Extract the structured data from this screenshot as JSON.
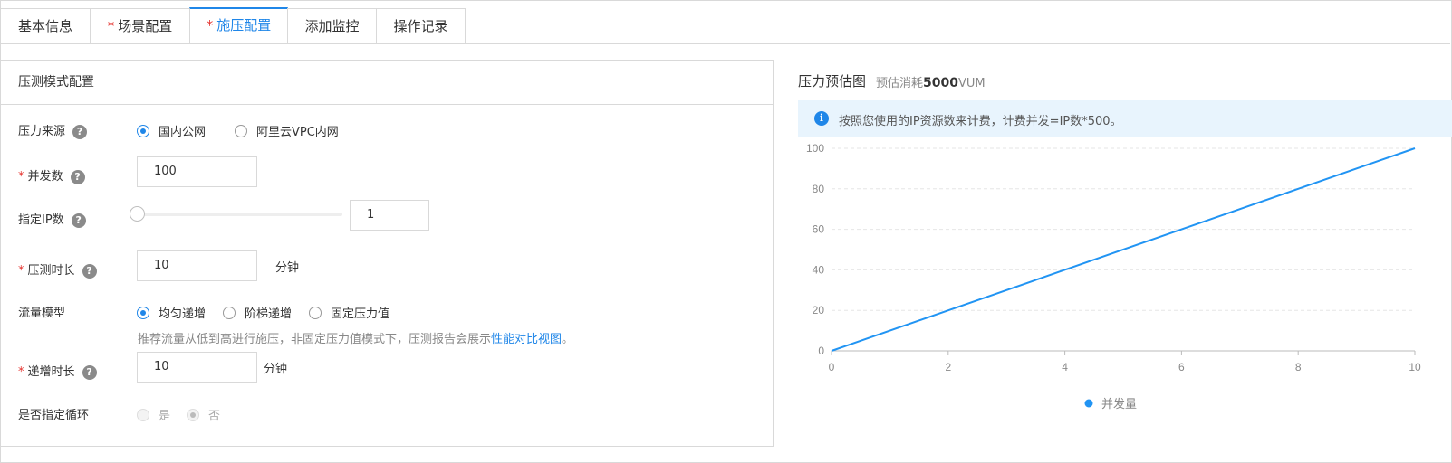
{
  "tabs": [
    {
      "label": "基本信息",
      "required": false,
      "active": false
    },
    {
      "label": "场景配置",
      "required": true,
      "active": false
    },
    {
      "label": "施压配置",
      "required": true,
      "active": true
    },
    {
      "label": "添加监控",
      "required": false,
      "active": false
    },
    {
      "label": "操作记录",
      "required": false,
      "active": false
    }
  ],
  "panel": {
    "title": "压测模式配置",
    "pressure_source": {
      "label": "压力来源",
      "options": [
        "国内公网",
        "阿里云VPC内网"
      ],
      "selected": "国内公网"
    },
    "concurrency": {
      "label": "并发数",
      "value": "100"
    },
    "ip_count": {
      "label": "指定IP数",
      "value": "1",
      "slider_fraction": 0
    },
    "duration": {
      "label": "压测时长",
      "value": "10",
      "unit": "分钟"
    },
    "traffic_model": {
      "label": "流量模型",
      "options": [
        "均匀递增",
        "阶梯递增",
        "固定压力值"
      ],
      "selected": "均匀递增"
    },
    "hint": {
      "text": "推荐流量从低到高进行施压，非固定压力值模式下，压测报告会展示",
      "link": "性能对比视图",
      "suffix": "。"
    },
    "ramp_duration": {
      "label": "递增时长",
      "value": "10",
      "unit": "分钟"
    },
    "loop": {
      "label": "是否指定循环",
      "options": [
        "是",
        "否"
      ],
      "selected": "否",
      "disabled": true
    },
    "help_glyph": "?"
  },
  "chart_panel": {
    "title": "压力预估图",
    "cost_prefix": "预估消耗",
    "cost_value": "5000",
    "cost_unit": "VUM",
    "info_glyph": "i",
    "notice": "按照您使用的IP资源数来计费，计费并发=IP数*500。"
  },
  "colors": {
    "accent": "#1f86e8",
    "required": "#e5332f",
    "line": "#2194f3"
  },
  "chart_data": {
    "type": "line",
    "x": [
      0,
      10
    ],
    "series": [
      {
        "name": "并发量",
        "values": [
          0,
          100
        ]
      }
    ],
    "xlim": [
      0,
      10
    ],
    "ylim": [
      0,
      100
    ],
    "xticks": [
      "0",
      "2",
      "4",
      "6",
      "8",
      "10"
    ],
    "yticks": [
      "0",
      "20",
      "40",
      "60",
      "80",
      "100"
    ],
    "grid": true,
    "legend": "bottom-center"
  }
}
